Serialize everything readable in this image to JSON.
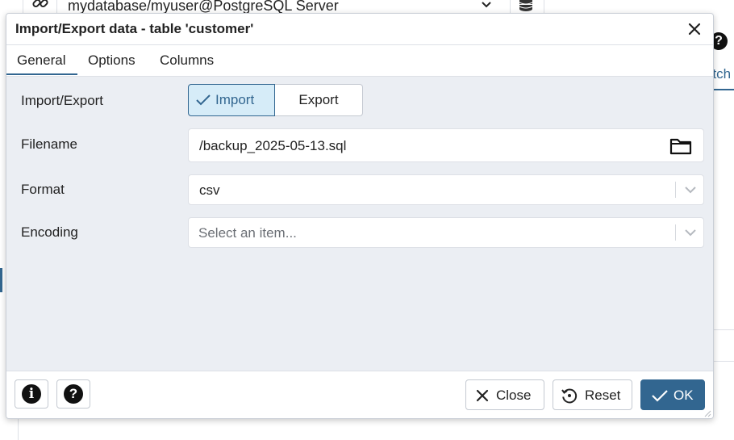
{
  "background": {
    "connection_label": "mydatabase/myuser@PostgreSQL Server",
    "tab_partial_label": "atch"
  },
  "dialog": {
    "title": "Import/Export data - table 'customer'",
    "tabs": [
      {
        "label": "General",
        "active": true
      },
      {
        "label": "Options",
        "active": false
      },
      {
        "label": "Columns",
        "active": false
      }
    ],
    "fields": {
      "import_export": {
        "label": "Import/Export",
        "options": [
          "Import",
          "Export"
        ],
        "selected": "Import"
      },
      "filename": {
        "label": "Filename",
        "value": "/backup_2025-05-13.sql"
      },
      "format": {
        "label": "Format",
        "value": "csv"
      },
      "encoding": {
        "label": "Encoding",
        "placeholder": "Select an item..."
      }
    },
    "footer": {
      "close_label": "Close",
      "reset_label": "Reset",
      "ok_label": "OK"
    }
  },
  "colors": {
    "accent": "#326690",
    "selected_bg": "#d6ecf8",
    "dialog_bg": "#ebeef3"
  },
  "icons": {
    "connection": "link-icon",
    "database": "database-icon",
    "help": "question-circle-icon",
    "info": "info-circle-icon",
    "browse": "folder-icon",
    "close": "close-icon",
    "reset": "reset-icon",
    "ok": "check-icon"
  }
}
